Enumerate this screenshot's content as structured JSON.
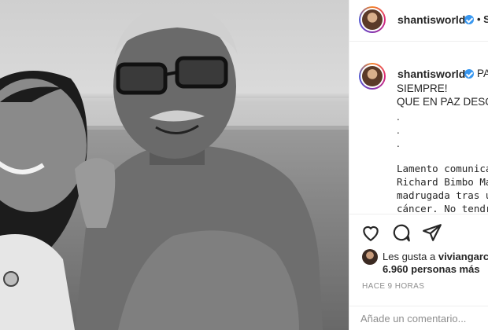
{
  "post": {
    "username": "shantisworld",
    "header_follow": "• S",
    "caption_lines": [
      "PA",
      "SIEMPRE!",
      "QUE EN PAZ DESCA",
      ".",
      ".",
      "."
    ],
    "caption_message_lines": [
      "Lamento comunica",
      "Richard Bimbo Mac",
      "madrugada tras un",
      "cáncer. No tendren"
    ],
    "likes_prefix": "Les gusta a",
    "likes_user": "viviangarc",
    "likes_count": "6.960 personas más",
    "timestamp": "HACE 9 HORAS",
    "comment_placeholder": "Añade un comentario..."
  },
  "icons": [
    "heart-icon",
    "comment-icon",
    "share-icon",
    "verified-badge-icon"
  ],
  "colors": {
    "accent": "#3897f0",
    "text": "#262626",
    "muted": "#8e8e8e",
    "border": "#efefef"
  }
}
